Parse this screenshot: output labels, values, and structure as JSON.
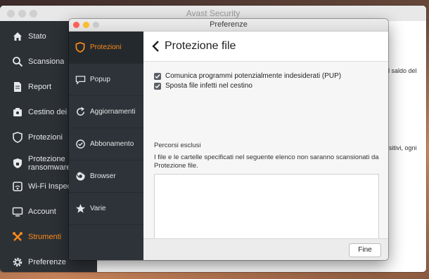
{
  "main_window": {
    "title": "Avast Security",
    "sidebar": [
      {
        "label": "Stato",
        "icon": "home-icon"
      },
      {
        "label": "Scansiona",
        "icon": "search-icon"
      },
      {
        "label": "Report",
        "icon": "document-icon"
      },
      {
        "label": "Cestino dei vi",
        "icon": "trash-icon"
      },
      {
        "label": "Protezioni",
        "icon": "shield-icon"
      },
      {
        "label": "Protezione ransomware",
        "icon": "ransomware-shield-icon"
      },
      {
        "label": "Wi-Fi Inspect",
        "icon": "wifi-icon"
      },
      {
        "label": "Account",
        "icon": "account-icon"
      },
      {
        "label": "Strumenti",
        "icon": "tools-icon",
        "active": true
      },
      {
        "label": "Preferenze",
        "icon": "gear-icon"
      }
    ],
    "background_text": [
      "il saldo del",
      "sitivi, ogni"
    ]
  },
  "preferences": {
    "title": "Preferenze",
    "sidebar": [
      {
        "label": "Protezioni",
        "icon": "shield-icon",
        "active": true
      },
      {
        "label": "Popup",
        "icon": "popup-icon"
      },
      {
        "label": "Aggiornamenti",
        "icon": "update-icon"
      },
      {
        "label": "Abbonamento",
        "icon": "subscription-icon"
      },
      {
        "label": "Browser",
        "icon": "browser-icon"
      },
      {
        "label": "Varie",
        "icon": "star-icon"
      }
    ],
    "heading": "Protezione file",
    "checkboxes": [
      {
        "label": "Comunica programmi potenzialmente indesiderati (PUP)",
        "checked": true
      },
      {
        "label": "Sposta file infetti nel cestino",
        "checked": true
      }
    ],
    "excluded_paths": {
      "title": "Percorsi esclusi",
      "description": "I file e le cartelle specificati nel seguente elenco non saranno scansionati da Protezione file.",
      "add_label": "+",
      "remove_label": "−"
    },
    "done_button": "Fine"
  },
  "colors": {
    "accent": "#ff8a1a",
    "sidebar_bg": "#2d3338"
  }
}
